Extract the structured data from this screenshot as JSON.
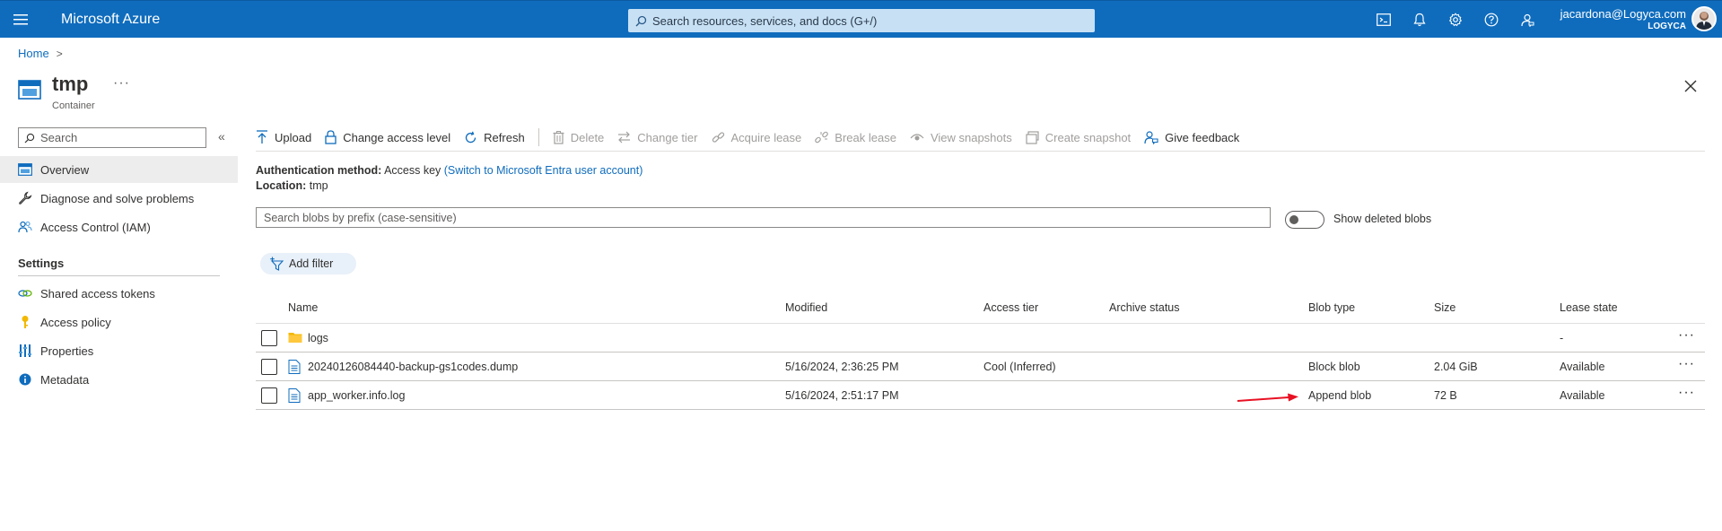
{
  "topbar": {
    "brand": "Microsoft Azure",
    "search_placeholder": "Search resources, services, and docs (G+/)",
    "user": "jacardona@Logyca.com",
    "tenant": "LOGYCA",
    "icons": [
      "cloud-shell-icon",
      "bell-icon",
      "gear-icon",
      "help-icon",
      "feedback-icon"
    ]
  },
  "breadcrumb": {
    "home": "Home",
    "separator": ">"
  },
  "resource": {
    "title": "tmp",
    "subtitle": "Container",
    "more": "···"
  },
  "nav": {
    "search_placeholder": "Search",
    "collapse": "«",
    "items": [
      {
        "label": "Overview",
        "icon": "overview-icon"
      },
      {
        "label": "Diagnose and solve problems",
        "icon": "wrench-icon"
      },
      {
        "label": "Access Control (IAM)",
        "icon": "people-icon"
      }
    ],
    "section_settings": "Settings",
    "settings_items": [
      {
        "label": "Shared access tokens",
        "icon": "link-icon"
      },
      {
        "label": "Access policy",
        "icon": "key-icon"
      },
      {
        "label": "Properties",
        "icon": "properties-icon"
      },
      {
        "label": "Metadata",
        "icon": "info-icon"
      }
    ]
  },
  "toolbar": {
    "upload": "Upload",
    "change_access_level": "Change access level",
    "refresh": "Refresh",
    "delete": "Delete",
    "change_tier": "Change tier",
    "acquire_lease": "Acquire lease",
    "break_lease": "Break lease",
    "view_snapshots": "View snapshots",
    "create_snapshot": "Create snapshot",
    "give_feedback": "Give feedback"
  },
  "info": {
    "auth_label": "Authentication method:",
    "auth_value": "Access key",
    "auth_link": "(Switch to Microsoft Entra user account)",
    "location_label": "Location:",
    "location_value": "tmp"
  },
  "blob_search": {
    "placeholder": "Search blobs by prefix (case-sensitive)"
  },
  "show_deleted": {
    "label": "Show deleted blobs",
    "on": false
  },
  "add_filter": "Add filter",
  "table": {
    "columns": [
      "Name",
      "Modified",
      "Access tier",
      "Archive status",
      "Blob type",
      "Size",
      "Lease state"
    ],
    "rows": [
      {
        "kind": "folder",
        "name": "logs",
        "modified": "",
        "access_tier": "",
        "archive_status": "",
        "blob_type": "",
        "size": "",
        "lease_state": "-"
      },
      {
        "kind": "file",
        "name": "20240126084440-backup-gs1codes.dump",
        "modified": "5/16/2024, 2:36:25 PM",
        "access_tier": "Cool (Inferred)",
        "archive_status": "",
        "blob_type": "Block blob",
        "size": "2.04 GiB",
        "lease_state": "Available"
      },
      {
        "kind": "file",
        "name": "app_worker.info.log",
        "modified": "5/16/2024, 2:51:17 PM",
        "access_tier": "",
        "archive_status": "",
        "blob_type": "Append blob",
        "size": "72 B",
        "lease_state": "Available"
      }
    ],
    "row_more": "···"
  },
  "colors": {
    "brand_blue": "#0f6cbd",
    "annotation_arrow": "#e81123",
    "folder": "#f2b800"
  }
}
